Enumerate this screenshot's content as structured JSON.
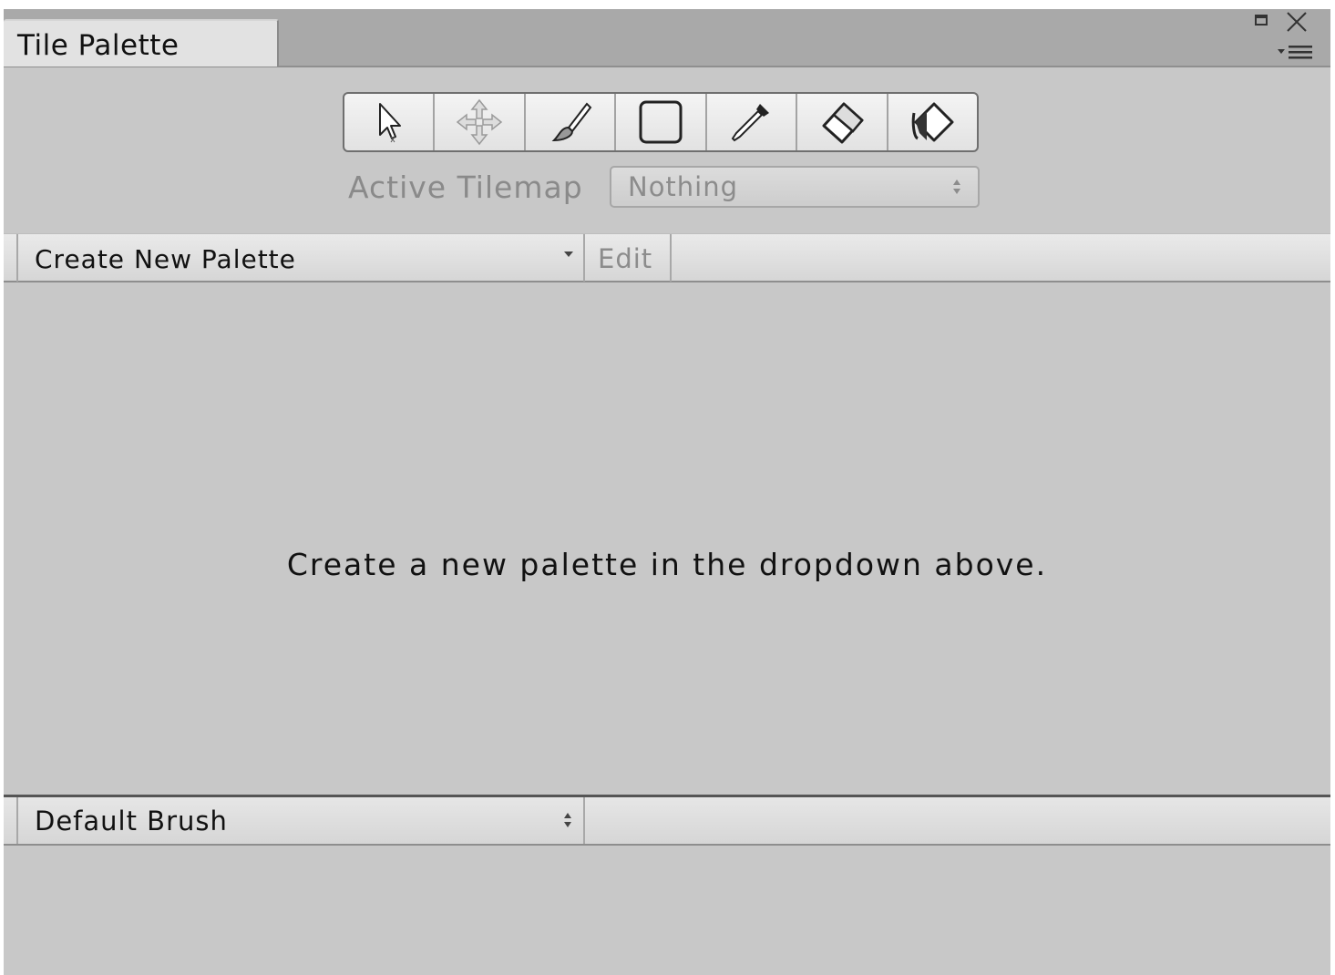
{
  "window": {
    "tab_title": "Tile Palette",
    "controls": [
      "maximize-icon",
      "close-icon",
      "menu-icon"
    ]
  },
  "toolbar": {
    "tools": [
      {
        "name": "select-tool",
        "icon": "arrow-cursor-icon"
      },
      {
        "name": "move-tool",
        "icon": "move-arrows-icon"
      },
      {
        "name": "paint-tool",
        "icon": "brush-icon"
      },
      {
        "name": "box-fill-tool",
        "icon": "rectangle-icon"
      },
      {
        "name": "picker-tool",
        "icon": "eyedropper-icon"
      },
      {
        "name": "erase-tool",
        "icon": "eraser-icon"
      },
      {
        "name": "fill-tool",
        "icon": "paint-bucket-icon"
      }
    ]
  },
  "active_tilemap": {
    "label": "Active Tilemap",
    "value": "Nothing"
  },
  "palette_bar": {
    "dropdown_label": "Create New Palette",
    "edit_label": "Edit"
  },
  "main": {
    "empty_message": "Create a new palette in the dropdown above."
  },
  "brush_bar": {
    "brush_label": "Default Brush"
  },
  "colors": {
    "panel_bg": "#c8c8c8",
    "titlebar_bg": "#a9a9a9",
    "tab_bg": "#e2e2e2",
    "disabled_text": "#8a8a8a"
  }
}
